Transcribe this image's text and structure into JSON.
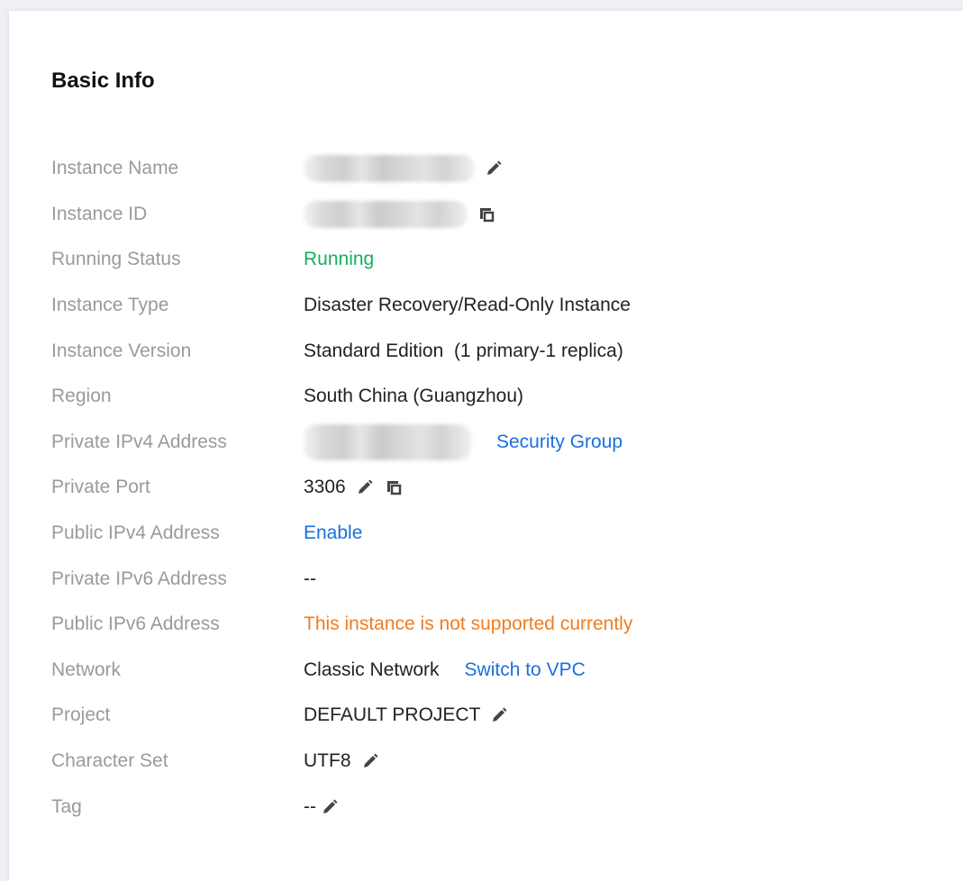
{
  "section": {
    "title": "Basic Info"
  },
  "rows": {
    "instance_name": {
      "label": "Instance Name"
    },
    "instance_id": {
      "label": "Instance ID"
    },
    "running_status": {
      "label": "Running Status",
      "value": "Running"
    },
    "instance_type": {
      "label": "Instance Type",
      "value": "Disaster Recovery/Read-Only Instance"
    },
    "instance_version": {
      "label": "Instance Version",
      "value": "Standard Edition  (1 primary-1 replica)"
    },
    "region": {
      "label": "Region",
      "value": "South China (Guangzhou)"
    },
    "private_ipv4": {
      "label": "Private IPv4 Address",
      "link": "Security Group"
    },
    "private_port": {
      "label": "Private Port",
      "value": "3306"
    },
    "public_ipv4": {
      "label": "Public IPv4 Address",
      "link": "Enable"
    },
    "private_ipv6": {
      "label": "Private IPv6 Address",
      "value": "--"
    },
    "public_ipv6": {
      "label": "Public IPv6 Address",
      "value": "This instance is not supported currently"
    },
    "network": {
      "label": "Network",
      "value": "Classic Network",
      "link": "Switch to VPC"
    },
    "project": {
      "label": "Project",
      "value": "DEFAULT PROJECT"
    },
    "character_set": {
      "label": "Character Set",
      "value": "UTF8"
    },
    "tag": {
      "label": "Tag",
      "value": "--"
    }
  },
  "icons": {
    "edit": "pencil-icon",
    "copy": "copy-icon"
  },
  "colors": {
    "label": "#9a9a9a",
    "running": "#1aad5e",
    "link": "#1a6fe0",
    "warning": "#f07c1f"
  }
}
